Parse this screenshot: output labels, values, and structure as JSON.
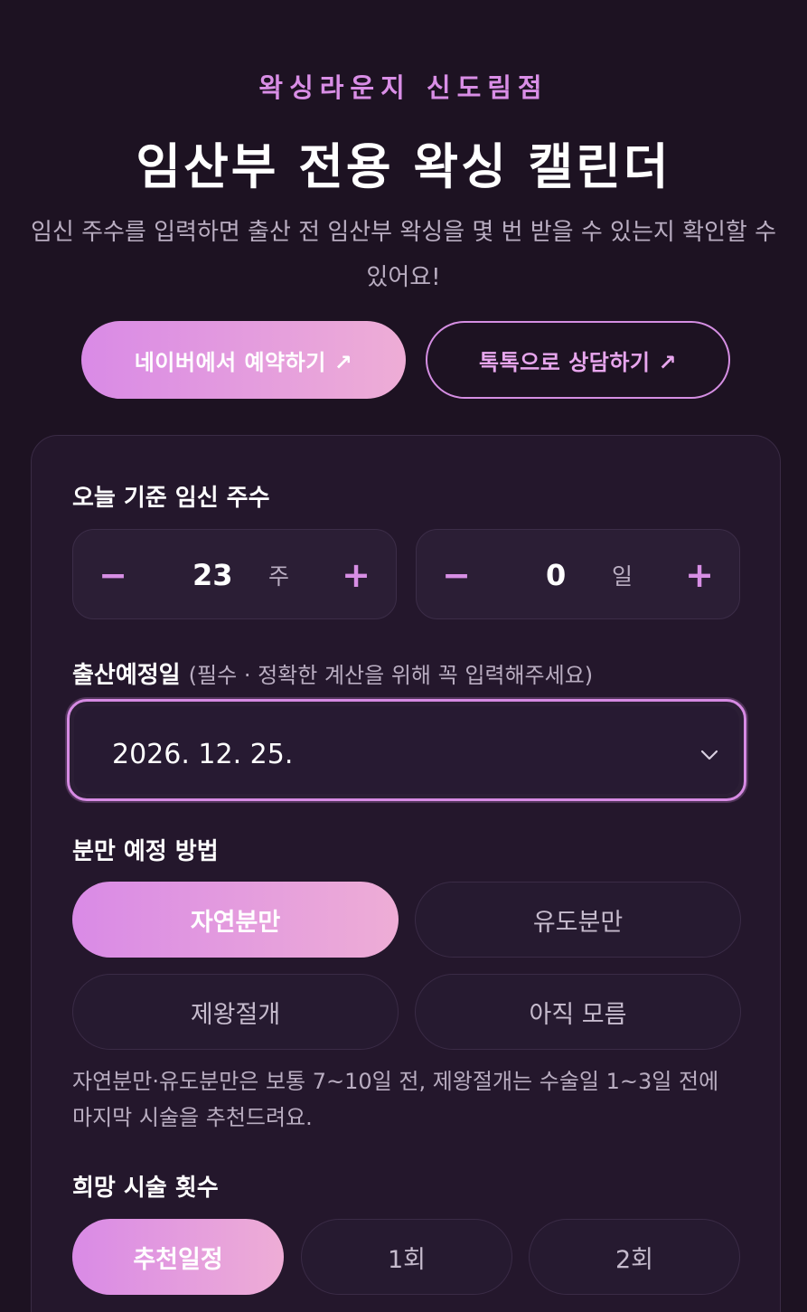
{
  "header": {
    "brand": "왁싱라운지 신도림점",
    "title": "임산부 전용 왁싱 캘린더",
    "description": "임신 주수를 입력하면 출산 전 임산부 왁싱을 몇 번 받을 수 있는지 확인할 수 있어요!"
  },
  "cta": {
    "naver_label": "네이버에서 예약하기 ↗",
    "talk_label": "톡톡으로 상담하기 ↗"
  },
  "pregnancy": {
    "label": "오늘 기준 임신 주수",
    "weeks": {
      "value": "23",
      "unit": "주",
      "minus": "−",
      "plus": "+"
    },
    "days": {
      "value": "0",
      "unit": "일",
      "minus": "−",
      "plus": "+"
    }
  },
  "due_date": {
    "label": "출산예정일",
    "hint": "(필수 · 정확한 계산을 위해 꼭 입력해주세요)",
    "value": "2026. 12. 25."
  },
  "delivery": {
    "label": "분만 예정 방법",
    "options": [
      "자연분만",
      "유도분만",
      "제왕절개",
      "아직 모름"
    ],
    "selected": "자연분만",
    "note": "자연분만·유도분만은 보통 7~10일 전, 제왕절개는 수술일 1~3일 전에 마지막 시술을 추천드려요."
  },
  "sessions": {
    "label": "희망 시술 횟수",
    "options": [
      "추천일정",
      "1회",
      "2회"
    ],
    "selected": "추천일정"
  },
  "colors": {
    "background": "#1d1222",
    "card": "#24172c",
    "accent": "#d98ae6",
    "accent_light": "#eeadd6",
    "muted_text": "#b9adc1"
  }
}
